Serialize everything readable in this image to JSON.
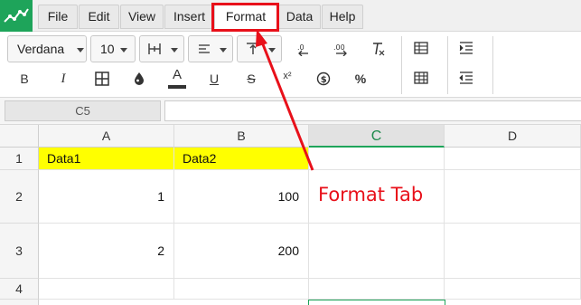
{
  "menu": {
    "items": [
      {
        "label": "File"
      },
      {
        "label": "Edit"
      },
      {
        "label": "View"
      },
      {
        "label": "Insert"
      },
      {
        "label": "Format"
      },
      {
        "label": "Data"
      },
      {
        "label": "Help"
      }
    ],
    "active": "Format"
  },
  "toolbar": {
    "font_family": "Verdana",
    "font_size": "10",
    "bold_label": "B",
    "italic_label": "I",
    "text_color_label": "A",
    "underline_label": "U",
    "strike_label": "S",
    "superscript_label": "x²",
    "percent_label": "%",
    "icons": [
      "borders-icon",
      "fill-color-icon",
      "text-color-icon",
      "align-left-icon",
      "vertical-align-icon",
      "decrease-decimal-icon",
      "increase-decimal-icon",
      "clear-format-icon",
      "currency-icon",
      "percent-icon",
      "table-icon",
      "increase-indent-icon",
      "decrease-indent-icon"
    ]
  },
  "formula_bar": {
    "cell_ref": "C5",
    "value": ""
  },
  "grid": {
    "columns": [
      "A",
      "B",
      "C",
      "D"
    ],
    "selected_column": "C",
    "rows": [
      {
        "num": "1",
        "A": "Data1",
        "B": "Data2",
        "C": "",
        "D": ""
      },
      {
        "num": "2",
        "A": "1",
        "B": "100",
        "C": "",
        "D": ""
      },
      {
        "num": "3",
        "A": "2",
        "B": "200",
        "C": "",
        "D": ""
      },
      {
        "num": "4",
        "A": "",
        "B": "",
        "C": "",
        "D": ""
      }
    ]
  },
  "annotation": {
    "text": "Format Tab",
    "color": "#e8101a"
  },
  "colors": {
    "brand": "#1ea45a",
    "header_fill": "#ffff00",
    "annotation": "#e8101a"
  }
}
